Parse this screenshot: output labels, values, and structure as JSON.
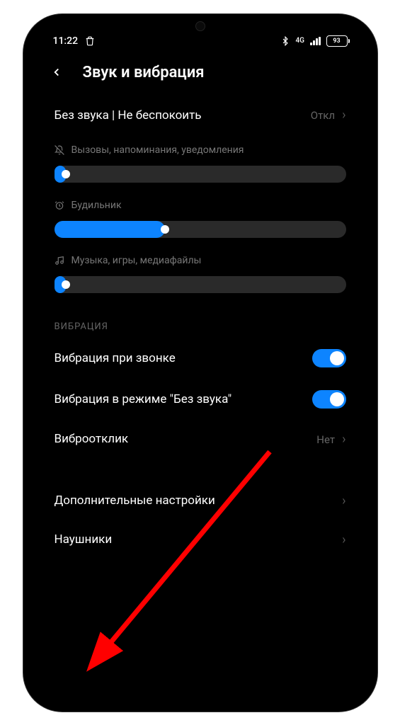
{
  "status": {
    "time": "11:22",
    "network_label": "4G",
    "battery_percent": "93"
  },
  "header": {
    "title": "Звук и вибрация"
  },
  "dnd": {
    "label": "Без звука | Не беспокоить",
    "value": "Откл"
  },
  "sliders": {
    "ringtone": {
      "label": "Вызовы, напоминания, уведомления",
      "value_pct": 4
    },
    "alarm": {
      "label": "Будильник",
      "value_pct": 38
    },
    "media": {
      "label": "Музыка, игры, медиафайлы",
      "value_pct": 4
    }
  },
  "vibration": {
    "section_title": "ВИБРАЦИЯ",
    "on_call": {
      "label": "Вибрация при звонке",
      "enabled": true
    },
    "silent_mode": {
      "label": "Вибрация в режиме \"Без звука\"",
      "enabled": true
    },
    "feedback": {
      "label": "Виброотклик",
      "value": "Нет"
    }
  },
  "extra": {
    "advanced": {
      "label": "Дополнительные настройки"
    },
    "headphones": {
      "label": "Наушники"
    }
  },
  "colors": {
    "accent": "#0d84ff",
    "bg": "#000000",
    "track": "#2a2a2a"
  }
}
